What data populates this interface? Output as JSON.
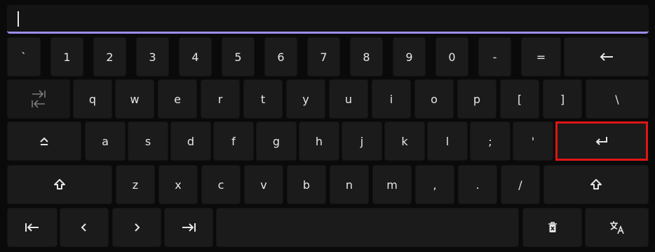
{
  "input": {
    "value": ""
  },
  "rows": [
    [
      {
        "name": "key-backtick",
        "label": "`"
      },
      {
        "name": "key-1",
        "label": "1"
      },
      {
        "name": "key-2",
        "label": "2"
      },
      {
        "name": "key-3",
        "label": "3"
      },
      {
        "name": "key-4",
        "label": "4"
      },
      {
        "name": "key-5",
        "label": "5"
      },
      {
        "name": "key-6",
        "label": "6"
      },
      {
        "name": "key-7",
        "label": "7"
      },
      {
        "name": "key-8",
        "label": "8"
      },
      {
        "name": "key-9",
        "label": "9"
      },
      {
        "name": "key-0",
        "label": "0"
      },
      {
        "name": "key-minus",
        "label": "-"
      },
      {
        "name": "key-equals",
        "label": "="
      },
      {
        "name": "key-backspace",
        "icon": "backspace-arrow-icon"
      }
    ],
    [
      {
        "name": "key-tab",
        "icon": "tab-icon",
        "disabled": true
      },
      {
        "name": "key-q",
        "label": "q"
      },
      {
        "name": "key-w",
        "label": "w"
      },
      {
        "name": "key-e",
        "label": "e"
      },
      {
        "name": "key-r",
        "label": "r"
      },
      {
        "name": "key-t",
        "label": "t"
      },
      {
        "name": "key-y",
        "label": "y"
      },
      {
        "name": "key-u",
        "label": "u"
      },
      {
        "name": "key-i",
        "label": "i"
      },
      {
        "name": "key-o",
        "label": "o"
      },
      {
        "name": "key-p",
        "label": "p"
      },
      {
        "name": "key-open-bracket",
        "label": "["
      },
      {
        "name": "key-close-bracket",
        "label": "]"
      },
      {
        "name": "key-backslash",
        "label": "\\"
      }
    ],
    [
      {
        "name": "key-caps-lock",
        "icon": "caps-lock-icon"
      },
      {
        "name": "key-a",
        "label": "a"
      },
      {
        "name": "key-s",
        "label": "s"
      },
      {
        "name": "key-d",
        "label": "d"
      },
      {
        "name": "key-f",
        "label": "f"
      },
      {
        "name": "key-g",
        "label": "g"
      },
      {
        "name": "key-h",
        "label": "h"
      },
      {
        "name": "key-j",
        "label": "j"
      },
      {
        "name": "key-k",
        "label": "k"
      },
      {
        "name": "key-l",
        "label": "l"
      },
      {
        "name": "key-semicolon",
        "label": ";"
      },
      {
        "name": "key-apostrophe",
        "label": "'"
      },
      {
        "name": "key-enter",
        "icon": "enter-icon",
        "highlight": true
      }
    ],
    [
      {
        "name": "key-shift-left",
        "icon": "shift-icon"
      },
      {
        "name": "key-z",
        "label": "z"
      },
      {
        "name": "key-x",
        "label": "x"
      },
      {
        "name": "key-c",
        "label": "c"
      },
      {
        "name": "key-v",
        "label": "v"
      },
      {
        "name": "key-b",
        "label": "b"
      },
      {
        "name": "key-n",
        "label": "n"
      },
      {
        "name": "key-m",
        "label": "m"
      },
      {
        "name": "key-comma",
        "label": ","
      },
      {
        "name": "key-period",
        "label": "."
      },
      {
        "name": "key-slash",
        "label": "/"
      },
      {
        "name": "key-shift-right",
        "icon": "shift-icon"
      }
    ],
    [
      {
        "name": "key-home",
        "icon": "home-arrow-icon"
      },
      {
        "name": "key-left",
        "icon": "left-chevron-icon"
      },
      {
        "name": "key-right",
        "icon": "right-chevron-icon"
      },
      {
        "name": "key-end",
        "icon": "end-arrow-icon"
      },
      {
        "name": "key-space",
        "label": ""
      },
      {
        "name": "key-clear",
        "icon": "trash-icon"
      },
      {
        "name": "key-language",
        "icon": "translate-icon"
      }
    ]
  ],
  "colors": {
    "accent": "#9d8cf0",
    "highlight": "#e01515",
    "key": "#1b1b1b",
    "background": "#0a0a0a"
  }
}
